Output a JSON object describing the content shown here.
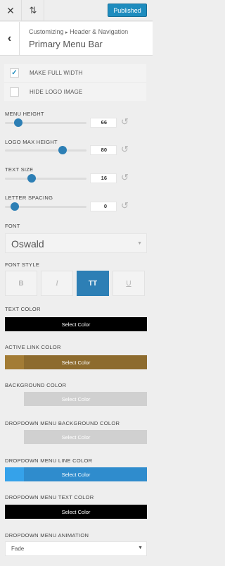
{
  "header": {
    "close_icon": "close-icon",
    "sort_icon": "sort-arrows-icon",
    "publish_label": "Published",
    "accent": "#1e8cbe"
  },
  "titlebar": {
    "back_icon": "chevron-left-icon",
    "breadcrumb_root": "Customizing",
    "breadcrumb_separator": "▸",
    "breadcrumb_section": "Header & Navigation",
    "title": "Primary Menu Bar"
  },
  "checkboxes": [
    {
      "label": "MAKE FULL WIDTH",
      "checked": true
    },
    {
      "label": "HIDE LOGO IMAGE",
      "checked": false
    }
  ],
  "sliders": {
    "menu_height": {
      "label": "MENU HEIGHT",
      "value": "66",
      "fraction": 0.16
    },
    "logo_max_height": {
      "label": "LOGO MAX HEIGHT",
      "value": "80",
      "fraction": 0.71
    },
    "text_size": {
      "label": "TEXT SIZE",
      "value": "16",
      "fraction": 0.33
    },
    "letter_spacing": {
      "label": "LETTER SPACING",
      "value": "0",
      "fraction": 0.12
    }
  },
  "font": {
    "label": "FONT",
    "selected": "Oswald"
  },
  "font_style": {
    "label": "FONT STYLE",
    "options": [
      {
        "glyph": "B",
        "name": "bold",
        "active": false
      },
      {
        "glyph": "I",
        "name": "italic",
        "active": false
      },
      {
        "glyph": "TT",
        "name": "uppercase",
        "active": true
      },
      {
        "glyph": "U",
        "name": "underline",
        "active": false
      }
    ]
  },
  "colors": [
    {
      "label": "TEXT COLOR",
      "button": "Select Color",
      "color": "#000000"
    },
    {
      "label": "ACTIVE LINK COLOR",
      "button": "Select Color",
      "color": "#8d6b2e"
    },
    {
      "label": "BACKGROUND COLOR",
      "button": "Select Color",
      "color": "#d0d0d0"
    },
    {
      "label": "DROPDOWN MENU BACKGROUND COLOR",
      "button": "Select Color",
      "color": "#d0d0d0"
    },
    {
      "label": "DROPDOWN MENU LINE COLOR",
      "button": "Select Color",
      "color": "#2f8ccd"
    },
    {
      "label": "DROPDOWN MENU TEXT COLOR",
      "button": "Select Color",
      "color": "#000000"
    }
  ],
  "animation": {
    "label": "DROPDOWN MENU ANIMATION",
    "selected": "Fade"
  }
}
